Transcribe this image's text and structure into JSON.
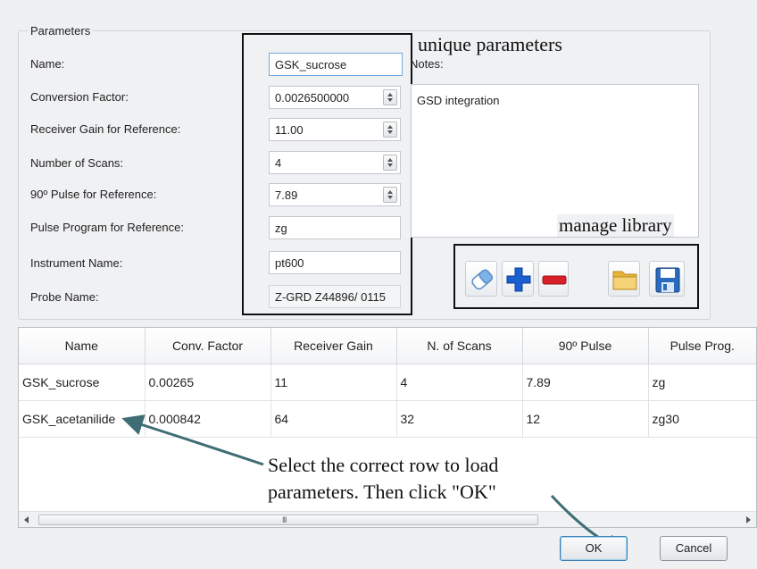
{
  "group": {
    "title": "Parameters"
  },
  "fields": [
    {
      "label": "Name:",
      "value": "GSK_sucrose",
      "spin": false
    },
    {
      "label": "Conversion Factor:",
      "value": "0.0026500000",
      "spin": true
    },
    {
      "label": "Receiver Gain for Reference:",
      "value": "11.00",
      "spin": true
    },
    {
      "label": "Number of Scans:",
      "value": "4",
      "spin": true
    },
    {
      "label": "90º Pulse for Reference:",
      "value": "7.89",
      "spin": true
    },
    {
      "label": "Pulse Program for Reference:",
      "value": "zg",
      "spin": false
    },
    {
      "label": "Instrument Name:",
      "value": "pt600",
      "spin": false
    },
    {
      "label": "Probe Name:",
      "value": "Z-GRD Z44896/ 0115",
      "spin": false
    }
  ],
  "notes": {
    "label": "Notes:",
    "value": "GSD integration"
  },
  "annotations": {
    "unique": "unique parameters",
    "manage": "manage library",
    "instruction_line1": "Select the correct row to load",
    "instruction_line2": "parameters. Then click \"OK\""
  },
  "toolbar": [
    {
      "name": "eraser-icon"
    },
    {
      "name": "plus-icon"
    },
    {
      "name": "minus-icon"
    },
    {
      "name": "folder-icon"
    },
    {
      "name": "save-icon"
    }
  ],
  "table": {
    "columns": [
      "Name",
      "Conv. Factor",
      "Receiver Gain",
      "N. of Scans",
      "90º Pulse",
      "Pulse Prog."
    ],
    "rows": [
      [
        "GSK_sucrose",
        "0.00265",
        "11",
        "4",
        "7.89",
        "zg"
      ],
      [
        "GSK_acetanilide",
        "0.000842",
        "64",
        "32",
        "12",
        "zg30"
      ]
    ],
    "scroll_grip": "III"
  },
  "buttons": {
    "ok": "OK",
    "cancel": "Cancel"
  },
  "colors": {
    "plus": "#1a5fd0",
    "minus": "#d8202a",
    "folder": "#f3c24a",
    "save": "#2a6bbf",
    "eraser": "#7db3e8"
  }
}
